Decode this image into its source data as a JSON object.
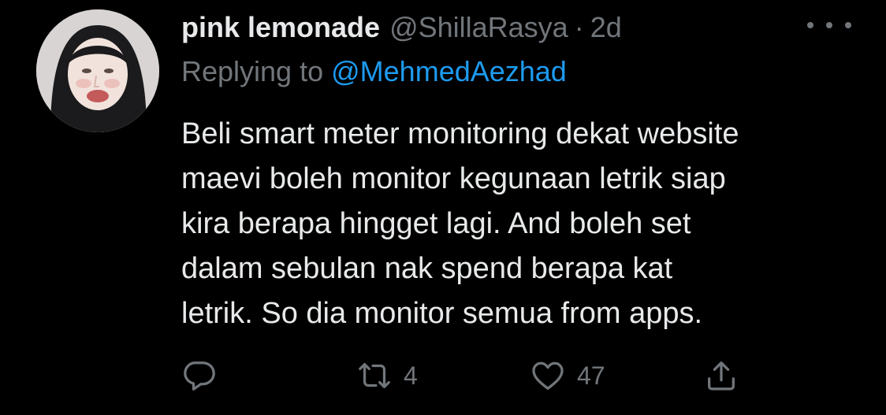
{
  "tweet": {
    "display_name": "pink lemonade",
    "handle": "@ShillaRasya",
    "separator": "·",
    "timestamp": "2d",
    "replying_prefix": "Replying to",
    "replying_to": "@MehmedAezhad",
    "body_lines": [
      "Beli smart meter monitoring dekat website",
      "maevi boleh monitor kegunaan letrik siap",
      "kira berapa hingget lagi. And boleh set",
      "dalam sebulan nak spend berapa kat",
      "letrik. So dia monitor semua from apps."
    ],
    "actions": {
      "reply_icon": "reply-icon",
      "retweet_icon": "retweet-icon",
      "retweet_count": "4",
      "like_icon": "heart-icon",
      "like_count": "47",
      "share_icon": "share-icon"
    },
    "colors": {
      "background": "#000000",
      "primary_text": "#e7e9ea",
      "secondary_text": "#71767b",
      "link": "#1d9bf0"
    }
  }
}
